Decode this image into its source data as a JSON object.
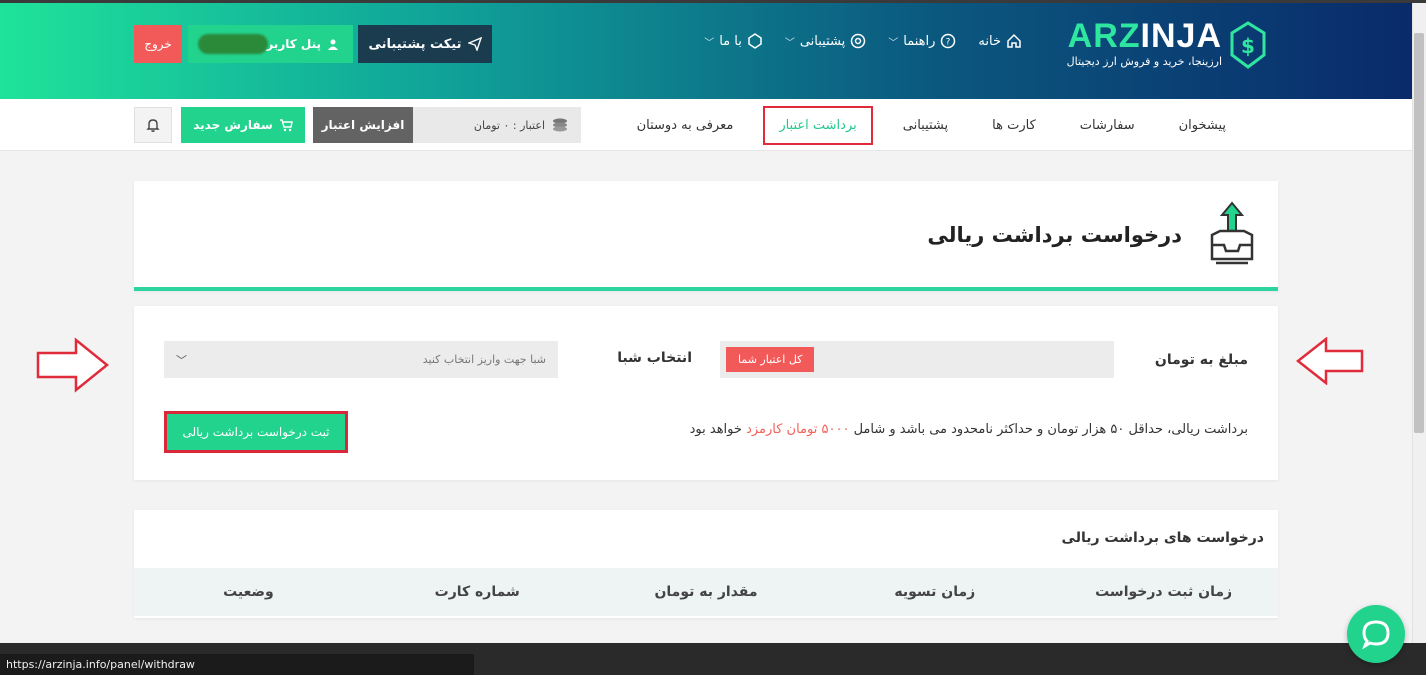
{
  "header": {
    "logo_prefix": "ARZ",
    "logo_suffix": "INJA",
    "tagline": "ارزینجا، خرید و فروش ارز دیجیتال",
    "nav": [
      {
        "label": "خانه",
        "icon": "home-icon"
      },
      {
        "label": "راهنما",
        "icon": "help-circle-icon"
      },
      {
        "label": "پشتیبانی",
        "icon": "lifebuoy-icon"
      },
      {
        "label": "با ما",
        "icon": "logo-mini-icon"
      }
    ],
    "ticket_button": "تیکت پشتیبانی",
    "panel_button": "پنل کاربری",
    "logout_button": "خروج"
  },
  "subnav": {
    "items": [
      "پیشخوان",
      "سفارشات",
      "کارت ها",
      "پشتیبانی",
      "برداشت اعتبار",
      "معرفی به دوستان"
    ],
    "active": "برداشت اعتبار",
    "credit_text": "اعتبار : ۰ تومان",
    "add_credit_button": "افزایش اعتبار",
    "new_order_button": "سفارش جدید"
  },
  "page": {
    "title": "درخواست برداشت ریالی"
  },
  "form": {
    "amount_label": "مبلغ به تومان",
    "all_credit_badge": "کل اعتبار شما",
    "sheba_label": "انتخاب شبا",
    "sheba_placeholder": "شبا جهت واریز انتخاب کنید",
    "note_prefix": "برداشت ریالی، حداقل ۵۰ هزار تومان و حداکثر نامحدود می باشد و شامل",
    "note_fee": "۵۰۰۰ تومان کارمزد",
    "note_suffix": "خواهد بود",
    "submit_button": "ثبت درخواست برداشت ریالی"
  },
  "history": {
    "title": "درخواست های برداشت ریالی",
    "columns": [
      "زمان ثبت درخواست",
      "زمان تسویه",
      "مقدار به تومان",
      "شماره کارت",
      "وضعیت"
    ]
  },
  "status_url": "https://arzinja.info/panel/withdraw",
  "colors": {
    "accent": "#22d38e",
    "danger": "#f25a5a",
    "highlight": "#e02b3b"
  }
}
